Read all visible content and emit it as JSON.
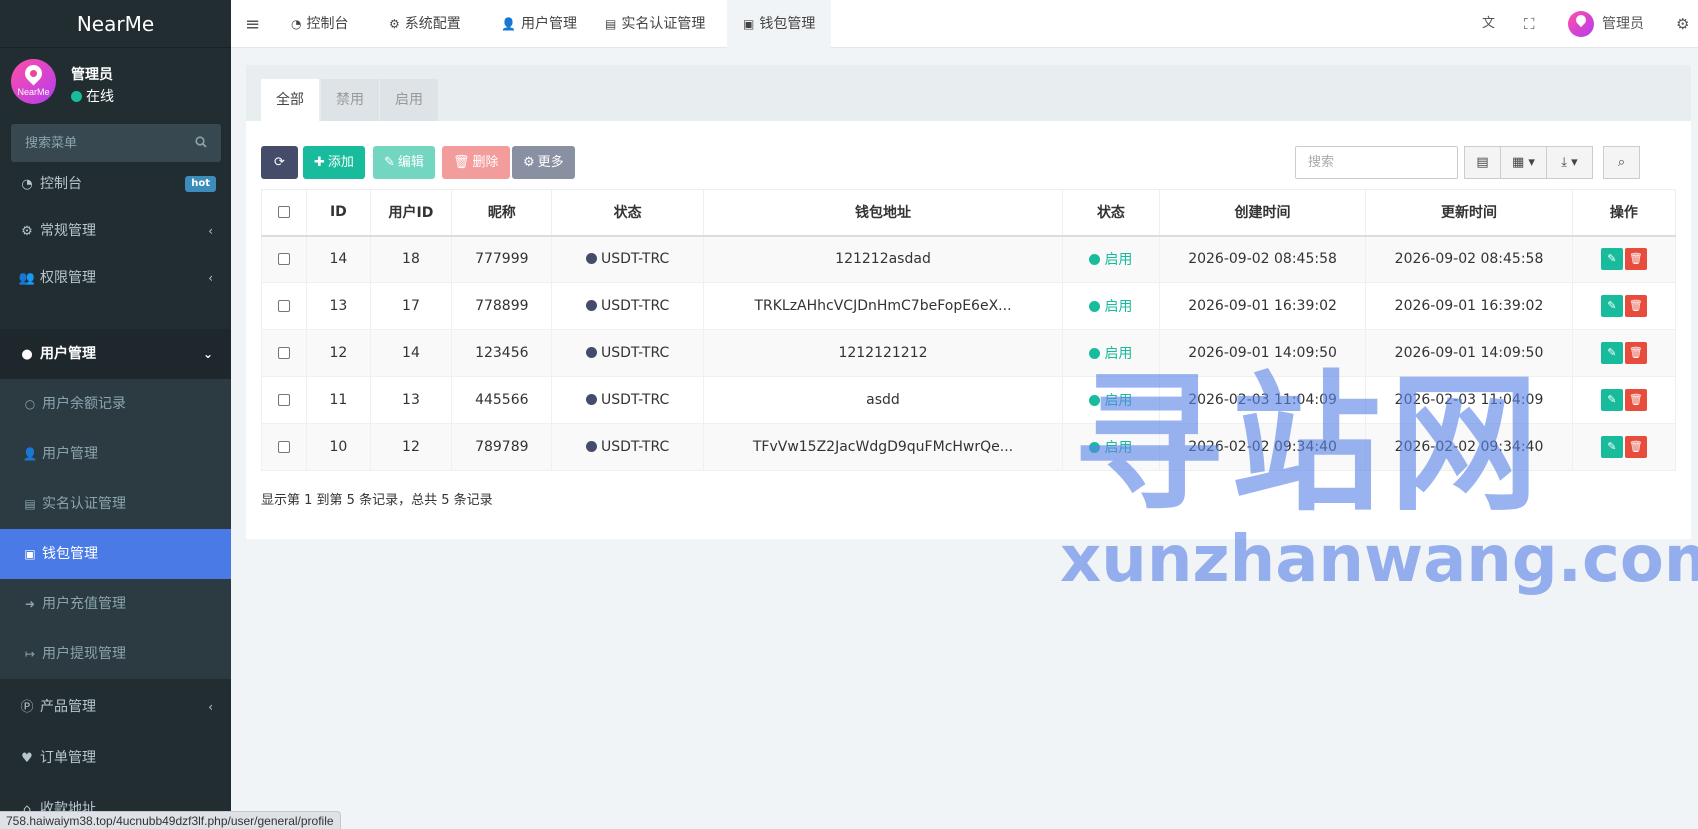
{
  "app": {
    "logo": "NearMe",
    "avatar_brand": "NearMe",
    "user_name": "管理员",
    "user_status": "在线"
  },
  "sidebar": {
    "search_placeholder": "搜索菜单",
    "items": [
      {
        "label": "控制台",
        "icon": "dashboard-icon",
        "badge": "hot"
      },
      {
        "label": "常规管理",
        "icon": "cogs-icon"
      },
      {
        "label": "权限管理",
        "icon": "group-icon"
      },
      {
        "label": "用户管理",
        "icon": "user-circle-icon"
      }
    ],
    "sub_items": [
      {
        "label": "用户余额记录",
        "icon": "circle-o-icon"
      },
      {
        "label": "用户管理",
        "icon": "user-icon"
      },
      {
        "label": "实名认证管理",
        "icon": "id-card-icon"
      },
      {
        "label": "钱包管理",
        "icon": "money-icon"
      },
      {
        "label": "用户充值管理",
        "icon": "sign-in-icon"
      },
      {
        "label": "用户提现管理",
        "icon": "sign-out-icon"
      }
    ],
    "bottom_items": [
      {
        "label": "产品管理",
        "icon": "product-icon"
      },
      {
        "label": "订单管理",
        "icon": "heartbeat-icon"
      },
      {
        "label": "收款地址",
        "icon": "map-icon"
      }
    ]
  },
  "topnav": {
    "tabs": [
      "控制台",
      "系统配置",
      "用户管理",
      "实名认证管理",
      "钱包管理"
    ],
    "admin_label": "管理员"
  },
  "panel": {
    "tabs": [
      "全部",
      "禁用",
      "启用"
    ],
    "buttons": {
      "add": "添加",
      "edit": "编辑",
      "delete": "删除",
      "more": "更多"
    },
    "search_placeholder": "搜索"
  },
  "table": {
    "headers": [
      "ID",
      "用户ID",
      "昵称",
      "状态",
      "钱包地址",
      "状态",
      "创建时间",
      "更新时间",
      "操作"
    ],
    "rows": [
      {
        "id": "14",
        "uid": "18",
        "nick": "777999",
        "type": "USDT-TRC",
        "addr": "121212asdad",
        "status": "启用",
        "created": "2026-09-02 08:45:58",
        "updated": "2026-09-02 08:45:58"
      },
      {
        "id": "13",
        "uid": "17",
        "nick": "778899",
        "type": "USDT-TRC",
        "addr": "TRKLzAHhcVCJDnHmC7beFopE6eX...",
        "status": "启用",
        "created": "2026-09-01 16:39:02",
        "updated": "2026-09-01 16:39:02"
      },
      {
        "id": "12",
        "uid": "14",
        "nick": "123456",
        "type": "USDT-TRC",
        "addr": "1212121212",
        "status": "启用",
        "created": "2026-09-01 14:09:50",
        "updated": "2026-09-01 14:09:50"
      },
      {
        "id": "11",
        "uid": "13",
        "nick": "445566",
        "type": "USDT-TRC",
        "addr": "asdd",
        "status": "启用",
        "created": "2026-02-03 11:04:09",
        "updated": "2026-02-03 11:04:09"
      },
      {
        "id": "10",
        "uid": "12",
        "nick": "789789",
        "type": "USDT-TRC",
        "addr": "TFvVw15Z2JacWdgD9quFMcHwrQe...",
        "status": "启用",
        "created": "2026-02-02 09:34:40",
        "updated": "2026-02-02 09:34:40"
      }
    ]
  },
  "pager_info": "显示第 1 到第 5 条记录，总共 5 条记录",
  "watermark": {
    "cn": "寻站网",
    "en": "xunzhanwang.com"
  },
  "status_url": "758.haiwaiym38.top/4ucnubb49dzf3lf.php/user/general/profile",
  "colors": {
    "sidebar_bg": "#222d32",
    "accent_blue": "#4a7ae6",
    "success": "#18bc9c",
    "danger": "#e74c3c",
    "primary_dark": "#444c69"
  }
}
